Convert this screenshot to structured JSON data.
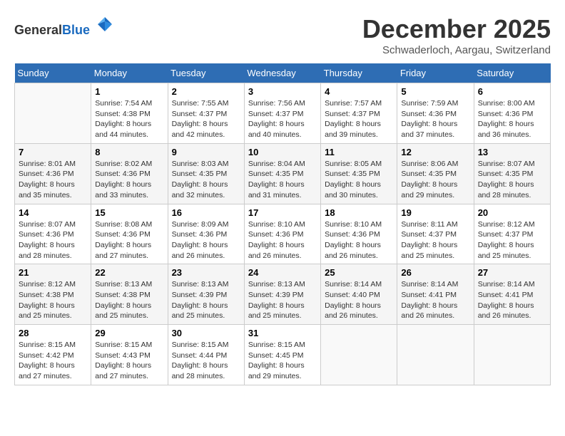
{
  "header": {
    "logo_general": "General",
    "logo_blue": "Blue",
    "month_title": "December 2025",
    "location": "Schwaderloch, Aargau, Switzerland"
  },
  "days_of_week": [
    "Sunday",
    "Monday",
    "Tuesday",
    "Wednesday",
    "Thursday",
    "Friday",
    "Saturday"
  ],
  "weeks": [
    [
      {
        "day": "",
        "sunrise": "",
        "sunset": "",
        "daylight": ""
      },
      {
        "day": "1",
        "sunrise": "Sunrise: 7:54 AM",
        "sunset": "Sunset: 4:38 PM",
        "daylight": "Daylight: 8 hours and 44 minutes."
      },
      {
        "day": "2",
        "sunrise": "Sunrise: 7:55 AM",
        "sunset": "Sunset: 4:37 PM",
        "daylight": "Daylight: 8 hours and 42 minutes."
      },
      {
        "day": "3",
        "sunrise": "Sunrise: 7:56 AM",
        "sunset": "Sunset: 4:37 PM",
        "daylight": "Daylight: 8 hours and 40 minutes."
      },
      {
        "day": "4",
        "sunrise": "Sunrise: 7:57 AM",
        "sunset": "Sunset: 4:37 PM",
        "daylight": "Daylight: 8 hours and 39 minutes."
      },
      {
        "day": "5",
        "sunrise": "Sunrise: 7:59 AM",
        "sunset": "Sunset: 4:36 PM",
        "daylight": "Daylight: 8 hours and 37 minutes."
      },
      {
        "day": "6",
        "sunrise": "Sunrise: 8:00 AM",
        "sunset": "Sunset: 4:36 PM",
        "daylight": "Daylight: 8 hours and 36 minutes."
      }
    ],
    [
      {
        "day": "7",
        "sunrise": "Sunrise: 8:01 AM",
        "sunset": "Sunset: 4:36 PM",
        "daylight": "Daylight: 8 hours and 35 minutes."
      },
      {
        "day": "8",
        "sunrise": "Sunrise: 8:02 AM",
        "sunset": "Sunset: 4:36 PM",
        "daylight": "Daylight: 8 hours and 33 minutes."
      },
      {
        "day": "9",
        "sunrise": "Sunrise: 8:03 AM",
        "sunset": "Sunset: 4:35 PM",
        "daylight": "Daylight: 8 hours and 32 minutes."
      },
      {
        "day": "10",
        "sunrise": "Sunrise: 8:04 AM",
        "sunset": "Sunset: 4:35 PM",
        "daylight": "Daylight: 8 hours and 31 minutes."
      },
      {
        "day": "11",
        "sunrise": "Sunrise: 8:05 AM",
        "sunset": "Sunset: 4:35 PM",
        "daylight": "Daylight: 8 hours and 30 minutes."
      },
      {
        "day": "12",
        "sunrise": "Sunrise: 8:06 AM",
        "sunset": "Sunset: 4:35 PM",
        "daylight": "Daylight: 8 hours and 29 minutes."
      },
      {
        "day": "13",
        "sunrise": "Sunrise: 8:07 AM",
        "sunset": "Sunset: 4:35 PM",
        "daylight": "Daylight: 8 hours and 28 minutes."
      }
    ],
    [
      {
        "day": "14",
        "sunrise": "Sunrise: 8:07 AM",
        "sunset": "Sunset: 4:36 PM",
        "daylight": "Daylight: 8 hours and 28 minutes."
      },
      {
        "day": "15",
        "sunrise": "Sunrise: 8:08 AM",
        "sunset": "Sunset: 4:36 PM",
        "daylight": "Daylight: 8 hours and 27 minutes."
      },
      {
        "day": "16",
        "sunrise": "Sunrise: 8:09 AM",
        "sunset": "Sunset: 4:36 PM",
        "daylight": "Daylight: 8 hours and 26 minutes."
      },
      {
        "day": "17",
        "sunrise": "Sunrise: 8:10 AM",
        "sunset": "Sunset: 4:36 PM",
        "daylight": "Daylight: 8 hours and 26 minutes."
      },
      {
        "day": "18",
        "sunrise": "Sunrise: 8:10 AM",
        "sunset": "Sunset: 4:36 PM",
        "daylight": "Daylight: 8 hours and 26 minutes."
      },
      {
        "day": "19",
        "sunrise": "Sunrise: 8:11 AM",
        "sunset": "Sunset: 4:37 PM",
        "daylight": "Daylight: 8 hours and 25 minutes."
      },
      {
        "day": "20",
        "sunrise": "Sunrise: 8:12 AM",
        "sunset": "Sunset: 4:37 PM",
        "daylight": "Daylight: 8 hours and 25 minutes."
      }
    ],
    [
      {
        "day": "21",
        "sunrise": "Sunrise: 8:12 AM",
        "sunset": "Sunset: 4:38 PM",
        "daylight": "Daylight: 8 hours and 25 minutes."
      },
      {
        "day": "22",
        "sunrise": "Sunrise: 8:13 AM",
        "sunset": "Sunset: 4:38 PM",
        "daylight": "Daylight: 8 hours and 25 minutes."
      },
      {
        "day": "23",
        "sunrise": "Sunrise: 8:13 AM",
        "sunset": "Sunset: 4:39 PM",
        "daylight": "Daylight: 8 hours and 25 minutes."
      },
      {
        "day": "24",
        "sunrise": "Sunrise: 8:13 AM",
        "sunset": "Sunset: 4:39 PM",
        "daylight": "Daylight: 8 hours and 25 minutes."
      },
      {
        "day": "25",
        "sunrise": "Sunrise: 8:14 AM",
        "sunset": "Sunset: 4:40 PM",
        "daylight": "Daylight: 8 hours and 26 minutes."
      },
      {
        "day": "26",
        "sunrise": "Sunrise: 8:14 AM",
        "sunset": "Sunset: 4:41 PM",
        "daylight": "Daylight: 8 hours and 26 minutes."
      },
      {
        "day": "27",
        "sunrise": "Sunrise: 8:14 AM",
        "sunset": "Sunset: 4:41 PM",
        "daylight": "Daylight: 8 hours and 26 minutes."
      }
    ],
    [
      {
        "day": "28",
        "sunrise": "Sunrise: 8:15 AM",
        "sunset": "Sunset: 4:42 PM",
        "daylight": "Daylight: 8 hours and 27 minutes."
      },
      {
        "day": "29",
        "sunrise": "Sunrise: 8:15 AM",
        "sunset": "Sunset: 4:43 PM",
        "daylight": "Daylight: 8 hours and 27 minutes."
      },
      {
        "day": "30",
        "sunrise": "Sunrise: 8:15 AM",
        "sunset": "Sunset: 4:44 PM",
        "daylight": "Daylight: 8 hours and 28 minutes."
      },
      {
        "day": "31",
        "sunrise": "Sunrise: 8:15 AM",
        "sunset": "Sunset: 4:45 PM",
        "daylight": "Daylight: 8 hours and 29 minutes."
      },
      {
        "day": "",
        "sunrise": "",
        "sunset": "",
        "daylight": ""
      },
      {
        "day": "",
        "sunrise": "",
        "sunset": "",
        "daylight": ""
      },
      {
        "day": "",
        "sunrise": "",
        "sunset": "",
        "daylight": ""
      }
    ]
  ]
}
